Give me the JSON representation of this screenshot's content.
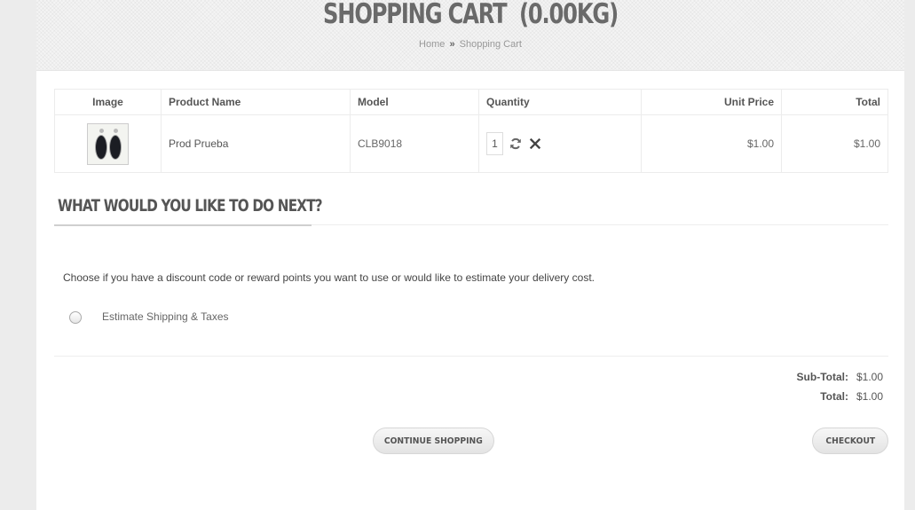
{
  "header": {
    "title": "SHOPPING CART  (0.00KG)",
    "breadcrumb": {
      "home": "Home",
      "separator": "»",
      "current": "Shopping Cart"
    }
  },
  "cart": {
    "columns": {
      "image": "Image",
      "name": "Product Name",
      "model": "Model",
      "quantity": "Quantity",
      "unit_price": "Unit Price",
      "total": "Total"
    },
    "rows": [
      {
        "image_icon": "earrings-product-image",
        "name": "Prod Prueba",
        "model": "CLB9018",
        "quantity": "1",
        "unit_price": "$1.00",
        "total": "$1.00"
      }
    ]
  },
  "next": {
    "heading": "WHAT WOULD YOU LIKE TO DO NEXT?",
    "description": "Choose if you have a discount code or reward points you want to use or would like to estimate your delivery cost.",
    "options": [
      {
        "label": "Estimate Shipping & Taxes",
        "selected": false
      }
    ]
  },
  "totals": [
    {
      "label": "Sub-Total:",
      "value": "$1.00"
    },
    {
      "label": "Total:",
      "value": "$1.00"
    }
  ],
  "buttons": {
    "continue": "CONTINUE SHOPPING",
    "checkout": "CHECKOUT"
  },
  "icons": {
    "update": "refresh-icon",
    "remove": "close-icon"
  },
  "colors": {
    "background": "#ececec",
    "content": "#ffffff",
    "text": "#555555"
  }
}
